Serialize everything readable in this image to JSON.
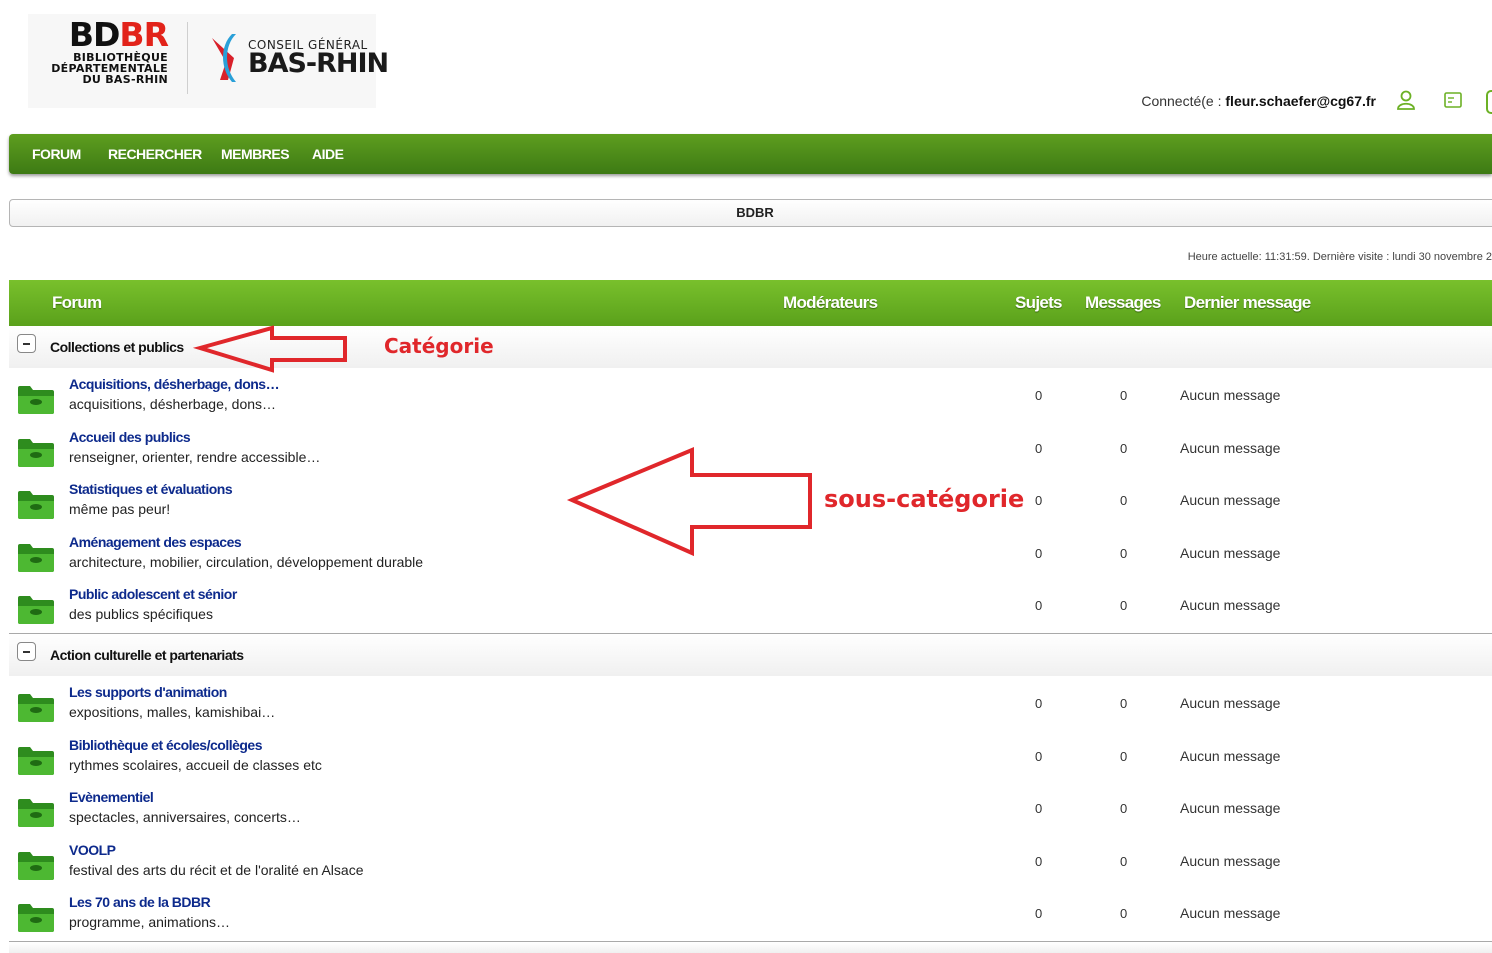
{
  "header": {
    "bdbr_logo": {
      "word_first": "BD",
      "word_second": "BR",
      "line1": "BIBLIOTHÈQUE",
      "line2": "DÉPARTEMENTALE",
      "line3": "DU BAS-RHIN"
    },
    "cg_logo": {
      "line1": "CONSEIL GÉNÉRAL",
      "line2": "BAS-RHIN"
    },
    "connected_label": "Connecté(e :",
    "connected_user": "fleur.schaefer@cg67.fr",
    "icons": [
      "user-icon",
      "message-icon"
    ]
  },
  "nav": {
    "items": [
      "FORUM",
      "RECHERCHER",
      "MEMBRES",
      "AIDE"
    ]
  },
  "breadcrumb": "BDBR",
  "time_info": "Heure actuelle: 11:31:59. Dernière visite : lundi 30 novembre 2",
  "table_header": {
    "forum": "Forum",
    "moderators": "Modérateurs",
    "topics": "Sujets",
    "posts": "Messages",
    "last_post": "Dernier message"
  },
  "categories": [
    {
      "title": "Collections et publics",
      "forums": [
        {
          "title": "Acquisitions, désherbage, dons…",
          "desc": "acquisitions, désherbage, dons…",
          "topics": "0",
          "posts": "0",
          "last": "Aucun message"
        },
        {
          "title": "Accueil des publics",
          "desc": "renseigner, orienter, rendre accessible…",
          "topics": "0",
          "posts": "0",
          "last": "Aucun message"
        },
        {
          "title": "Statistiques et évaluations",
          "desc": "même pas peur!",
          "topics": "0",
          "posts": "0",
          "last": "Aucun message"
        },
        {
          "title": "Aménagement des espaces",
          "desc": "architecture, mobilier, circulation, développement durable",
          "topics": "0",
          "posts": "0",
          "last": "Aucun message"
        },
        {
          "title": "Public adolescent et sénior",
          "desc": "des publics spécifiques",
          "topics": "0",
          "posts": "0",
          "last": "Aucun message"
        }
      ]
    },
    {
      "title": "Action culturelle et partenariats",
      "forums": [
        {
          "title": "Les supports d'animation",
          "desc": "expositions, malles, kamishibai…",
          "topics": "0",
          "posts": "0",
          "last": "Aucun message"
        },
        {
          "title": "Bibliothèque et écoles/collèges",
          "desc": "rythmes scolaires, accueil de classes etc",
          "topics": "0",
          "posts": "0",
          "last": "Aucun message"
        },
        {
          "title": "Evènementiel",
          "desc": "spectacles, anniversaires, concerts…",
          "topics": "0",
          "posts": "0",
          "last": "Aucun message"
        },
        {
          "title": "VOOLP",
          "desc": "festival des arts du récit et de l'oralité en Alsace",
          "topics": "0",
          "posts": "0",
          "last": "Aucun message"
        },
        {
          "title": "Les 70 ans de la BDBR",
          "desc": "programme, animations…",
          "topics": "0",
          "posts": "0",
          "last": "Aucun message"
        }
      ]
    }
  ],
  "annotations": {
    "category_label": "Catégorie",
    "subcategory_label": "sous-catégorie",
    "color": "#e0272b"
  },
  "colors": {
    "nav_green": "#4c8c19",
    "header_green": "#6cb125",
    "link_blue": "#0d2a8c"
  }
}
